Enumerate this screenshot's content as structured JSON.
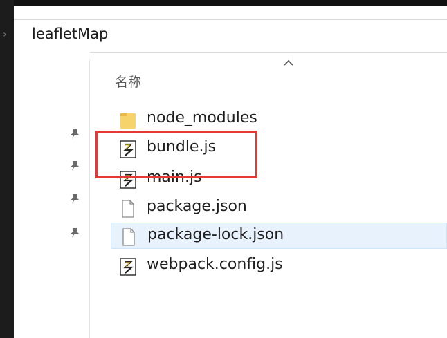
{
  "address": {
    "folder": "leafletMap"
  },
  "list": {
    "column_name": "名称",
    "files": [
      {
        "name": "node_modules",
        "type": "folder-icon"
      },
      {
        "name": "bundle.js",
        "type": "js-script-icon"
      },
      {
        "name": "main.js",
        "type": "js-script-icon"
      },
      {
        "name": "package.json",
        "type": "file-icon"
      },
      {
        "name": "package-lock.json",
        "type": "file-icon"
      },
      {
        "name": "webpack.config.js",
        "type": "js-script-icon"
      }
    ]
  },
  "colors": {
    "highlight": "#e53935",
    "hover": "#e8f2fc",
    "folder": "#f7d36b"
  }
}
